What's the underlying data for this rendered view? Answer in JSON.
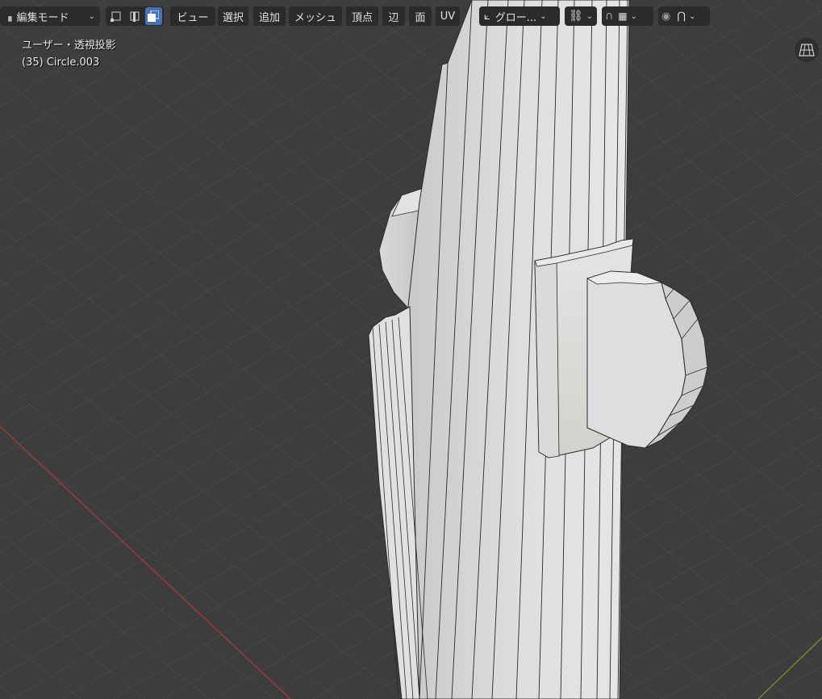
{
  "mode_select": {
    "label": "編集モード"
  },
  "menus": [
    {
      "label": "ビュー"
    },
    {
      "label": "選択"
    },
    {
      "label": "追加"
    },
    {
      "label": "メッシュ"
    },
    {
      "label": "頂点"
    },
    {
      "label": "辺"
    },
    {
      "label": "面"
    },
    {
      "label": "UV"
    }
  ],
  "transform_orientation": {
    "label": "グロー..."
  },
  "overlay": {
    "view_label": "ユーザー・透視投影",
    "object_label": "(35) Circle.003"
  },
  "icons": {
    "select_mode": [
      "vertex-select-icon",
      "edge-select-icon",
      "face-select-icon"
    ],
    "active_select_mode": "face-select-icon",
    "nav": "grid-view-icon"
  },
  "colors": {
    "viewport_bg": "#3d3d3d",
    "grid_line": "#474747",
    "x_axis": "#9a3a3a",
    "y_axis": "#6b8a2f",
    "mesh_face": "#d8d8d8",
    "mesh_edge": "#2a2a2a",
    "accent": "#4772b3"
  }
}
